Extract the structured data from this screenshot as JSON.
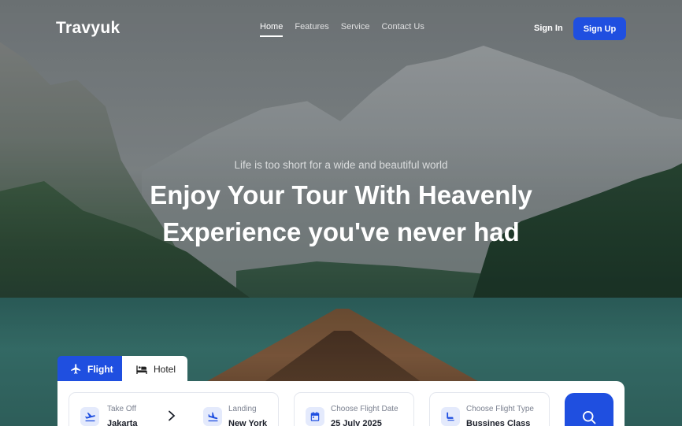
{
  "brand": {
    "logo": "Travyuk",
    "accent": "#1f4fe0"
  },
  "nav": {
    "items": [
      {
        "label": "Home",
        "active": true
      },
      {
        "label": "Features",
        "active": false
      },
      {
        "label": "Service",
        "active": false
      },
      {
        "label": "Contact Us",
        "active": false
      }
    ],
    "signin_label": "Sign In",
    "signup_label": "Sign Up"
  },
  "hero": {
    "tagline": "Life is too short for a wide and beautiful world",
    "headline_line1": "Enjoy Your Tour With Heavenly",
    "headline_line2": "Experience you've never had"
  },
  "booking": {
    "tabs": [
      {
        "label": "Flight",
        "icon": "plane-icon",
        "active": true
      },
      {
        "label": "Hotel",
        "icon": "bed-icon",
        "active": false
      }
    ],
    "take_off": {
      "label": "Take Off",
      "value": "Jakarta",
      "icon": "takeoff-icon"
    },
    "landing": {
      "label": "Landing",
      "value": "New York",
      "icon": "landing-icon"
    },
    "date": {
      "label": "Choose Flight Date",
      "value": "25 July 2025",
      "icon": "calendar-icon"
    },
    "type": {
      "label": "Choose Flight Type",
      "value": "Bussines Class",
      "icon": "seat-icon"
    },
    "search_icon": "search-icon"
  }
}
